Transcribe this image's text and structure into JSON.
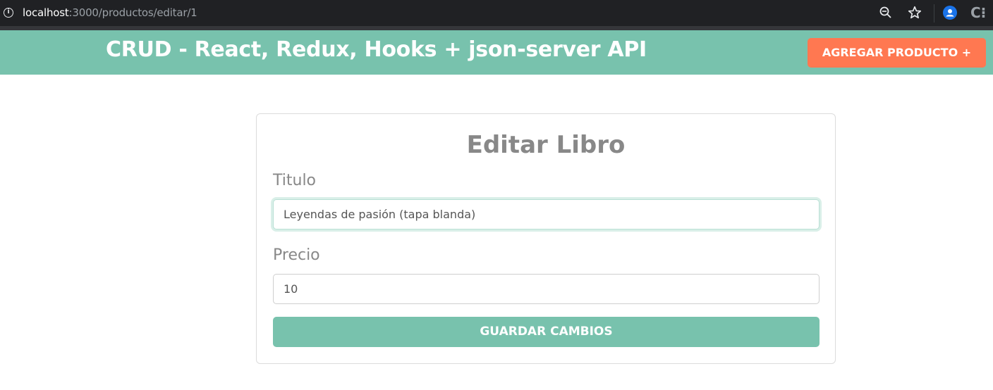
{
  "browser": {
    "url_host": "localhost",
    "url_path": ":3000/productos/editar/1",
    "zoom_icon": "zoom-out-icon",
    "bookmark_icon": "star-icon",
    "profile_icon": "profile-icon",
    "extension_icon": "extension-icon"
  },
  "header": {
    "title": "CRUD - React, Redux, Hooks + json-server API",
    "add_button_label": "AGREGAR PRODUCTO +"
  },
  "form": {
    "heading": "Editar Libro",
    "titulo_label": "Titulo",
    "titulo_value": "Leyendas de pasión (tapa blanda)",
    "precio_label": "Precio",
    "precio_value": "10",
    "save_label": "GUARDAR CAMBIOS"
  },
  "colors": {
    "primary": "#78c2ad",
    "secondary": "#ff7851",
    "text_muted": "#888888"
  }
}
